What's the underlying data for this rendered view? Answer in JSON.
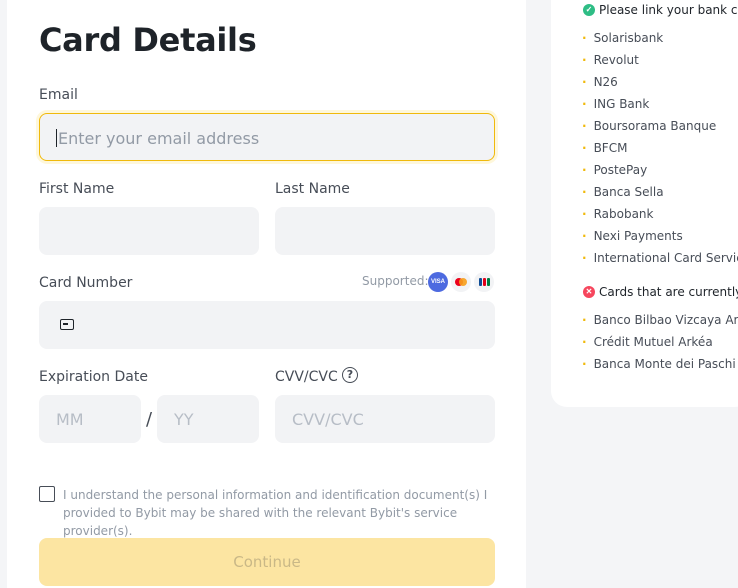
{
  "form": {
    "title": "Card Details",
    "email_label": "Email",
    "email_placeholder": "Enter your email address",
    "first_name_label": "First Name",
    "last_name_label": "Last Name",
    "card_number_label": "Card Number",
    "supported_label": "Supported:",
    "supported_cards": [
      "VISA",
      "Mastercard",
      "JCB"
    ],
    "expiration_label": "Expiration Date",
    "month_placeholder": "MM",
    "separator": "/",
    "year_placeholder": "YY",
    "cvv_label": "CVV/CVC",
    "cvv_help": "?",
    "cvv_placeholder": "CVV/CVC",
    "consent_text": "I understand the personal information and identification document(s) I provided to Bybit may be shared with the relevant Bybit's service provider(s).",
    "continue_label": "Continue"
  },
  "banks": {
    "supported_heading": "Please link your bank card",
    "supported": [
      "Solarisbank",
      "Revolut",
      "N26",
      "ING Bank",
      "Boursorama Banque",
      "BFCM",
      "PostePay",
      "Banca Sella",
      "Rabobank",
      "Nexi Payments",
      "International Card Services"
    ],
    "unsupported_heading": "Cards that are currently not supported",
    "unsupported": [
      "Banco Bilbao Vizcaya Argentaria",
      "Crédit Mutuel Arkéa",
      "Banca Monte dei Paschi di Siena"
    ]
  },
  "colors": {
    "accent": "#f0b90b",
    "button_disabled": "#fce5a2",
    "ok": "#2ebd85",
    "error": "#f6465d"
  }
}
